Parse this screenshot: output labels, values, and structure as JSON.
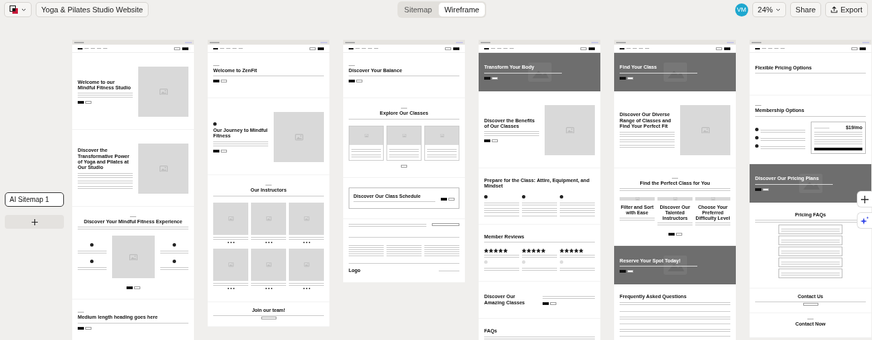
{
  "toolbar": {
    "project_title": "Yoga & Pilates Studio Website",
    "view_tabs": [
      {
        "label": "Sitemap",
        "selected": false
      },
      {
        "label": "Wireframe",
        "selected": true
      }
    ],
    "avatar": "VM",
    "zoom": "24%",
    "share": "Share",
    "export": "Export"
  },
  "sidebar": {
    "sitemap_name": "AI Sitemap 1"
  },
  "pages": [
    {
      "sections": [
        {
          "kind": "split",
          "heading": "Welcome to our Mindful Fitness Studio"
        },
        {
          "kind": "split-list",
          "heading": "Discover the Transformative Power of Yoga and Pilates at Our Studio"
        },
        {
          "kind": "features",
          "heading": "Discover Your Mindful Fitness Experience"
        },
        {
          "kind": "hero",
          "heading": "Medium length heading goes here"
        }
      ]
    },
    {
      "sections": [
        {
          "kind": "hero",
          "heading": "Welcome to ZenFit"
        },
        {
          "kind": "split-icon",
          "heading": "Our Journey to Mindful Fitness"
        },
        {
          "kind": "team",
          "heading": "Our Instructors"
        },
        {
          "kind": "small-cta",
          "heading": "Join our team!"
        }
      ]
    },
    {
      "sections": [
        {
          "kind": "hero",
          "heading": "Discover Your Balance"
        },
        {
          "kind": "cards",
          "heading": "Explore Our Classes"
        },
        {
          "kind": "box",
          "heading": "Discover Our Class Schedule"
        },
        {
          "kind": "footer",
          "heading": "Logo"
        }
      ]
    },
    {
      "sections": [
        {
          "kind": "banner",
          "heading": "Transform Your Body"
        },
        {
          "kind": "split",
          "heading": "Discover the Benefits of Our Classes"
        },
        {
          "kind": "columns",
          "heading": "Prepare for the Class: Attire, Equipment, and Mindset"
        },
        {
          "kind": "reviews",
          "heading": "Member Reviews",
          "reviews": [
            {
              "stars": 5
            },
            {
              "stars": 5
            },
            {
              "stars": 5
            }
          ]
        },
        {
          "kind": "cta",
          "heading": "Discover Our Amazing Classes"
        },
        {
          "kind": "faq",
          "heading": "FAQs"
        }
      ]
    },
    {
      "sections": [
        {
          "kind": "banner",
          "heading": "Find Your Class"
        },
        {
          "kind": "split-list",
          "heading": "Discover Our Diverse Range of Classes and Find Your Perfect Fit"
        },
        {
          "kind": "cards-titled",
          "heading": "Find the Perfect Class for You",
          "cards": [
            {
              "title": "Filter and Sort with Ease"
            },
            {
              "title": "Discover Our Talented Instructors"
            },
            {
              "title": "Choose Your Preferred Difficulty Level"
            }
          ]
        },
        {
          "kind": "banner",
          "heading": "Reserve Your Spot Today!"
        },
        {
          "kind": "faq",
          "heading": "Frequently Asked Questions"
        }
      ]
    },
    {
      "sections": [
        {
          "kind": "hero-plain",
          "heading": "Flexible Pricing Options"
        },
        {
          "kind": "pricing",
          "heading": "Membership Options",
          "price": "$19/mo"
        },
        {
          "kind": "banner",
          "heading": "Discover Our Pricing Plans"
        },
        {
          "kind": "faq-boxes",
          "heading": "Pricing FAQs"
        },
        {
          "kind": "small-cta",
          "heading": "Contact Us"
        },
        {
          "kind": "centered",
          "heading": "Contact Now"
        }
      ]
    }
  ]
}
